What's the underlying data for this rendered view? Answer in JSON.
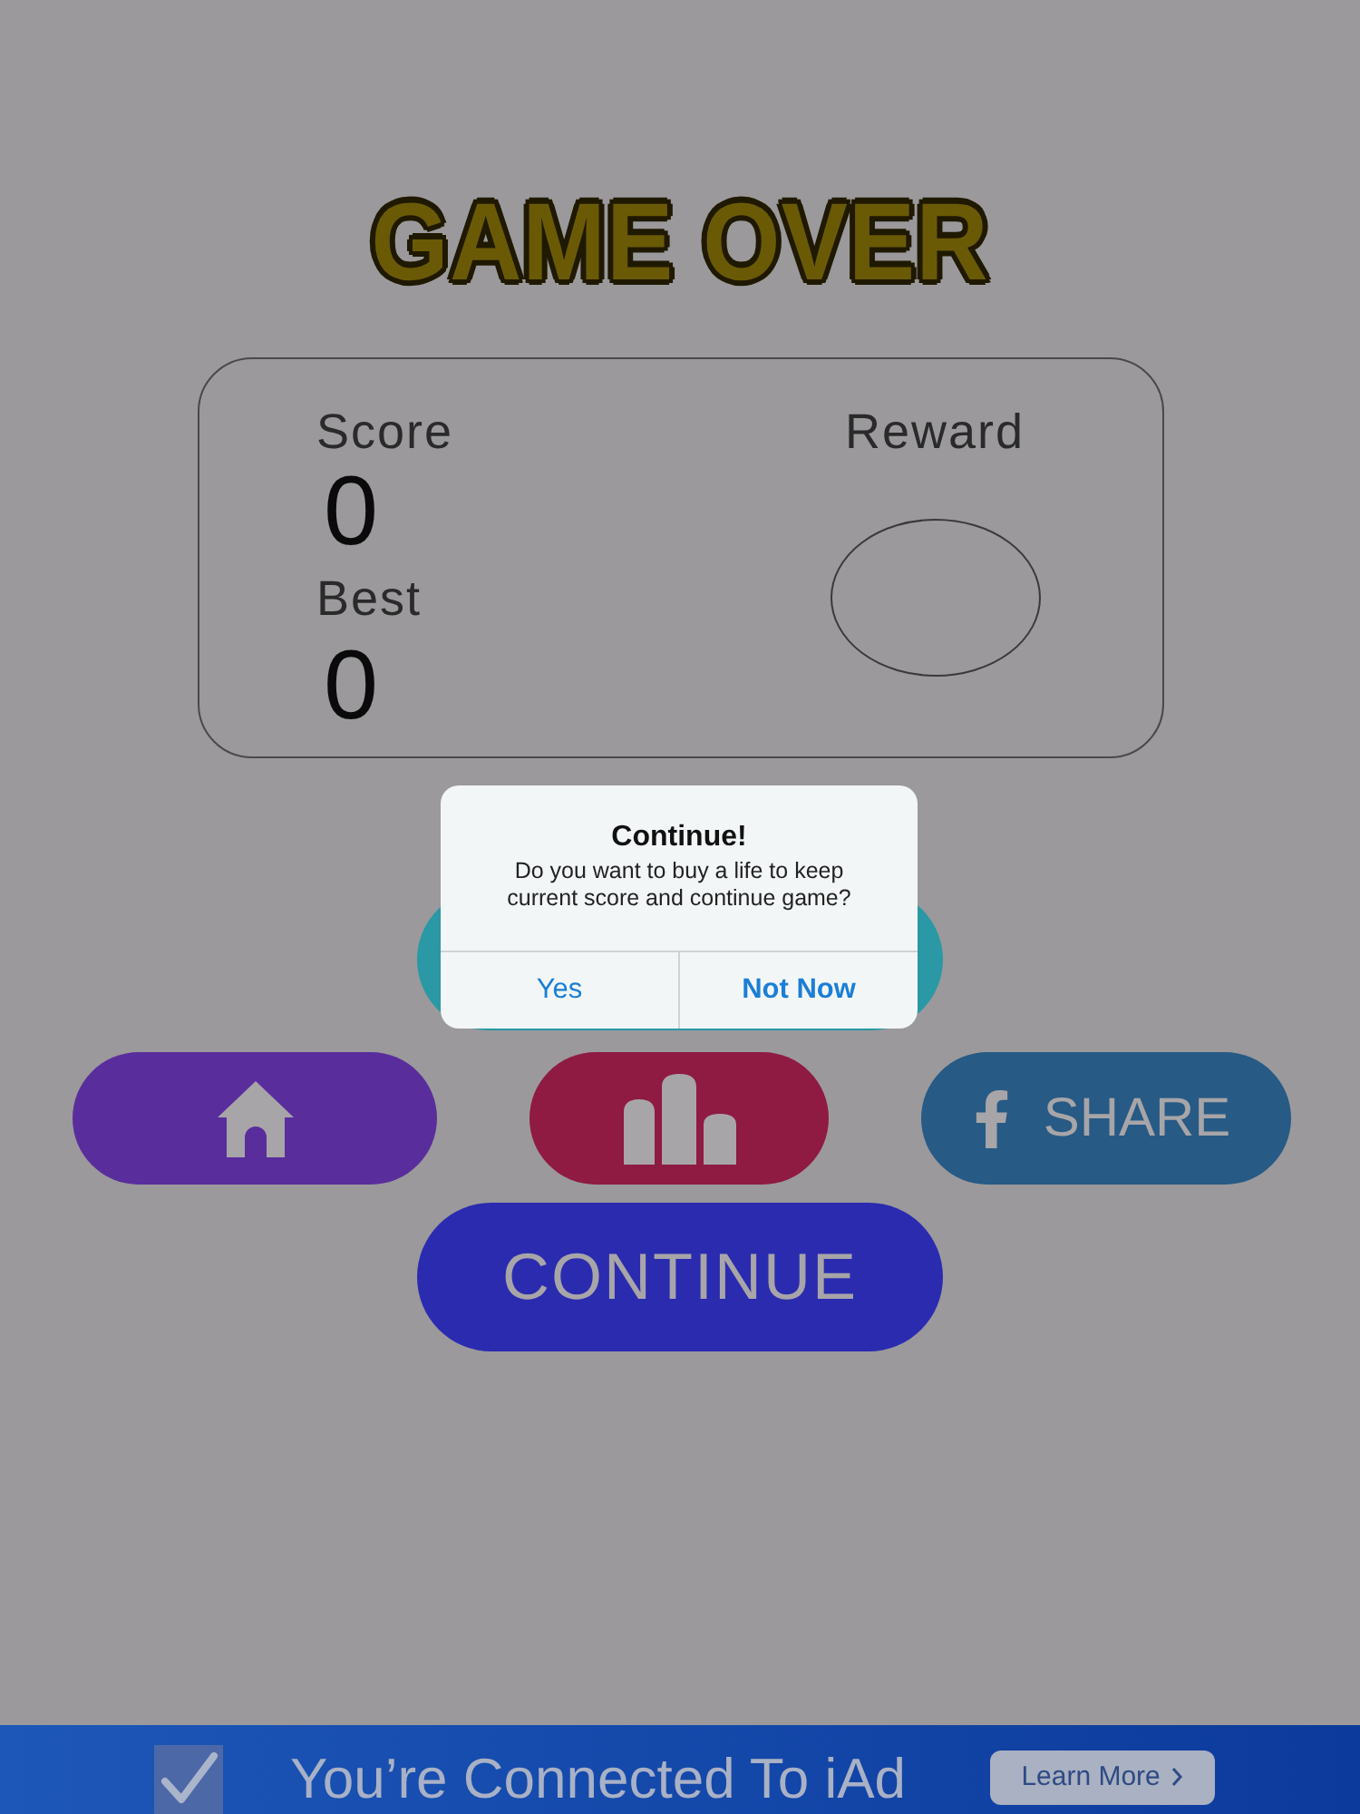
{
  "title": "GAME OVER",
  "score_card": {
    "score_label": "Score",
    "score": "0",
    "best_label": "Best",
    "best": "0",
    "reward_label": "Reward"
  },
  "menu_buttons": [
    {
      "kind": "home"
    },
    {
      "kind": "leaderboard"
    },
    {
      "kind": "share",
      "label": "SHARE"
    }
  ],
  "continue_button": {
    "label": "CONTINUE"
  },
  "dialog": {
    "title": "Continue!",
    "message": "Do you want to buy a life to keep current score and continue game?",
    "actions": [
      {
        "label": "Yes",
        "preferred": false
      },
      {
        "label": "Not Now",
        "preferred": true
      }
    ]
  },
  "ad_banner": {
    "text": "You’re Connected To iAd",
    "button": "Learn More"
  }
}
